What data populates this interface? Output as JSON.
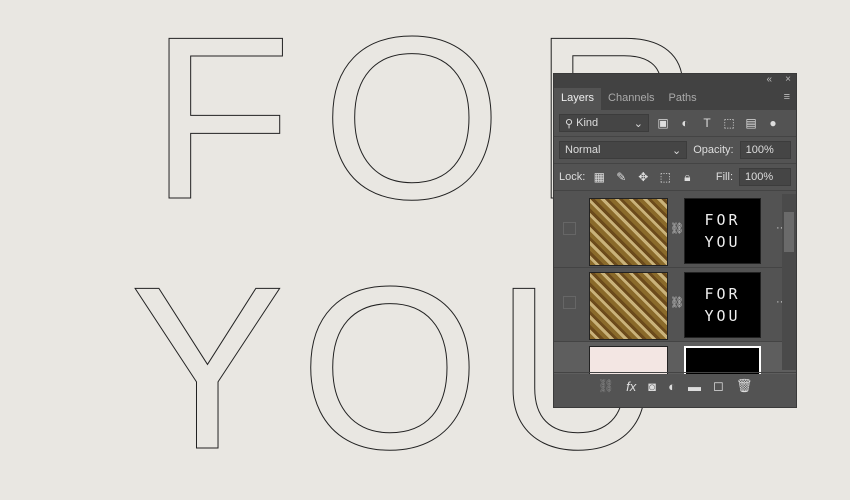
{
  "canvas": {
    "line1": "FOR",
    "line2": "YOU"
  },
  "panel": {
    "collapse_icon": "«",
    "close_icon": "×",
    "tabs": [
      {
        "label": "Layers"
      },
      {
        "label": "Channels"
      },
      {
        "label": "Paths"
      }
    ],
    "filter": {
      "label": "Kind"
    },
    "blend_mode": "Normal",
    "opacity_label": "Opacity:",
    "opacity_value": "100%",
    "lock_label": "Lock:",
    "fill_label": "Fill:",
    "fill_value": "100%",
    "layers": [
      {
        "mask_text": "FOR YOU"
      },
      {
        "mask_text": "FOR YOU"
      },
      {
        "mask_text": ""
      }
    ]
  }
}
